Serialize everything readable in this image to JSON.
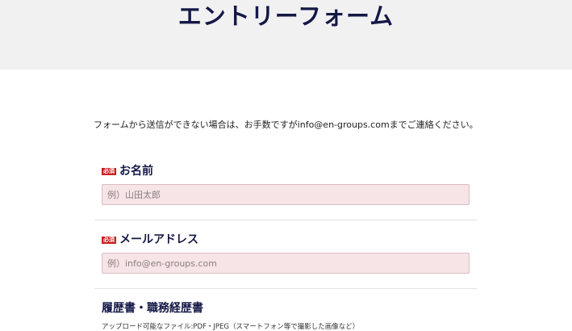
{
  "header": {
    "title": "エントリーフォーム"
  },
  "notice": "フォームから送信ができない場合は、お手数ですがinfo@en-groups.comまでご連絡ください。",
  "fields": {
    "name": {
      "badge": "必須",
      "label": "お名前",
      "placeholder": "例）山田太郎",
      "value": ""
    },
    "email": {
      "badge": "必須",
      "label": "メールアドレス",
      "placeholder": "例）info@en-groups.com",
      "value": ""
    },
    "resume": {
      "label": "履歴書・職務経歴書",
      "note": "アップロード可能なファイル:PDF・JPEG（スマートフォン等で撮影した画像など）"
    }
  }
}
